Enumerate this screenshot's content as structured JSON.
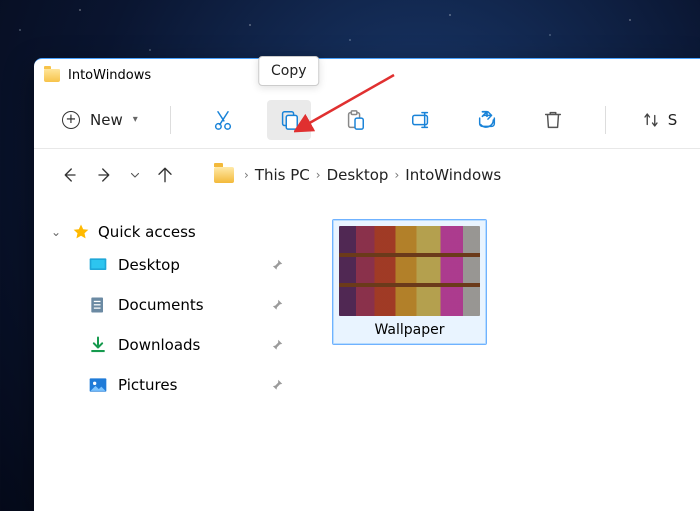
{
  "window": {
    "title": "IntoWindows"
  },
  "toolbar": {
    "new_label": "New",
    "copy_tooltip": "Copy",
    "sort_label_partial": "S"
  },
  "breadcrumb": {
    "items": [
      "This PC",
      "Desktop",
      "IntoWindows"
    ]
  },
  "sidebar": {
    "quick_access_label": "Quick access",
    "items": [
      {
        "label": "Desktop"
      },
      {
        "label": "Documents"
      },
      {
        "label": "Downloads"
      },
      {
        "label": "Pictures"
      }
    ]
  },
  "content": {
    "selected_item_label": "Wallpaper"
  },
  "icons": {
    "cut": "cut-icon",
    "copy": "copy-icon",
    "paste": "paste-icon",
    "rename": "rename-icon",
    "share": "share-icon",
    "delete": "delete-icon",
    "sort": "sort-icon"
  }
}
